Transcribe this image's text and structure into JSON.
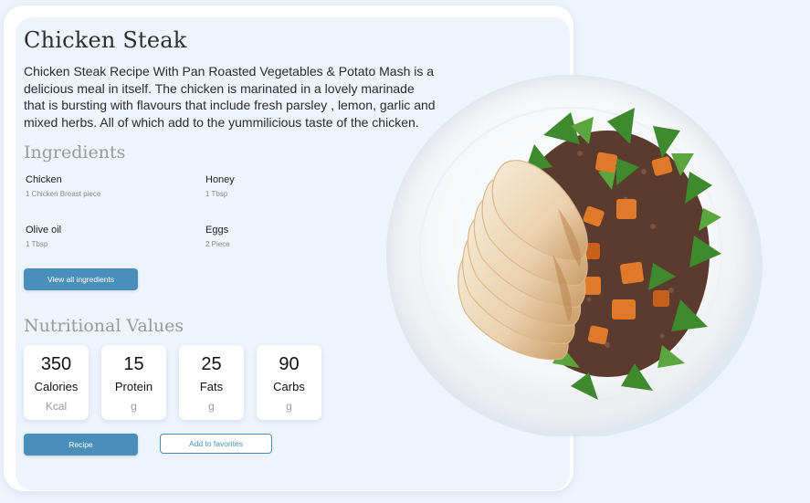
{
  "recipe": {
    "title": "Chicken Steak",
    "description": "Chicken Steak Recipe With Pan Roasted Vegetables & Potato Mash is a delicious meal in itself. The chicken is marinated in a lovely marinade that is bursting with flavours that include fresh parsley , lemon, garlic and mixed herbs. All of which add to the yummilicious taste of the chicken."
  },
  "ingredients": {
    "heading": "Ingredients",
    "items": [
      {
        "name": "Chicken",
        "qty": "1 Chicken Breast piece"
      },
      {
        "name": "Honey",
        "qty": "1 Tbsp"
      },
      {
        "name": "Olive oil",
        "qty": "1 Tbsp"
      },
      {
        "name": "Eggs",
        "qty": "2 Piece"
      }
    ],
    "view_all_label": "View all ingredients"
  },
  "nutrition": {
    "heading": "Nutritional Values",
    "items": [
      {
        "value": "350",
        "label": "Calories",
        "unit": "Kcal"
      },
      {
        "value": "15",
        "label": "Protein",
        "unit": "g"
      },
      {
        "value": "25",
        "label": "Fats",
        "unit": "g"
      },
      {
        "value": "90",
        "label": "Carbs",
        "unit": "g"
      }
    ]
  },
  "actions": {
    "recipe_label": "Recipe",
    "favorites_label": "Add to favorites"
  },
  "colors": {
    "background": "#eef4fc",
    "accent": "#4a8fba",
    "card": "#ffffff",
    "heading_muted": "#9a9a9a"
  },
  "image": {
    "icon": "food-plate-image"
  }
}
